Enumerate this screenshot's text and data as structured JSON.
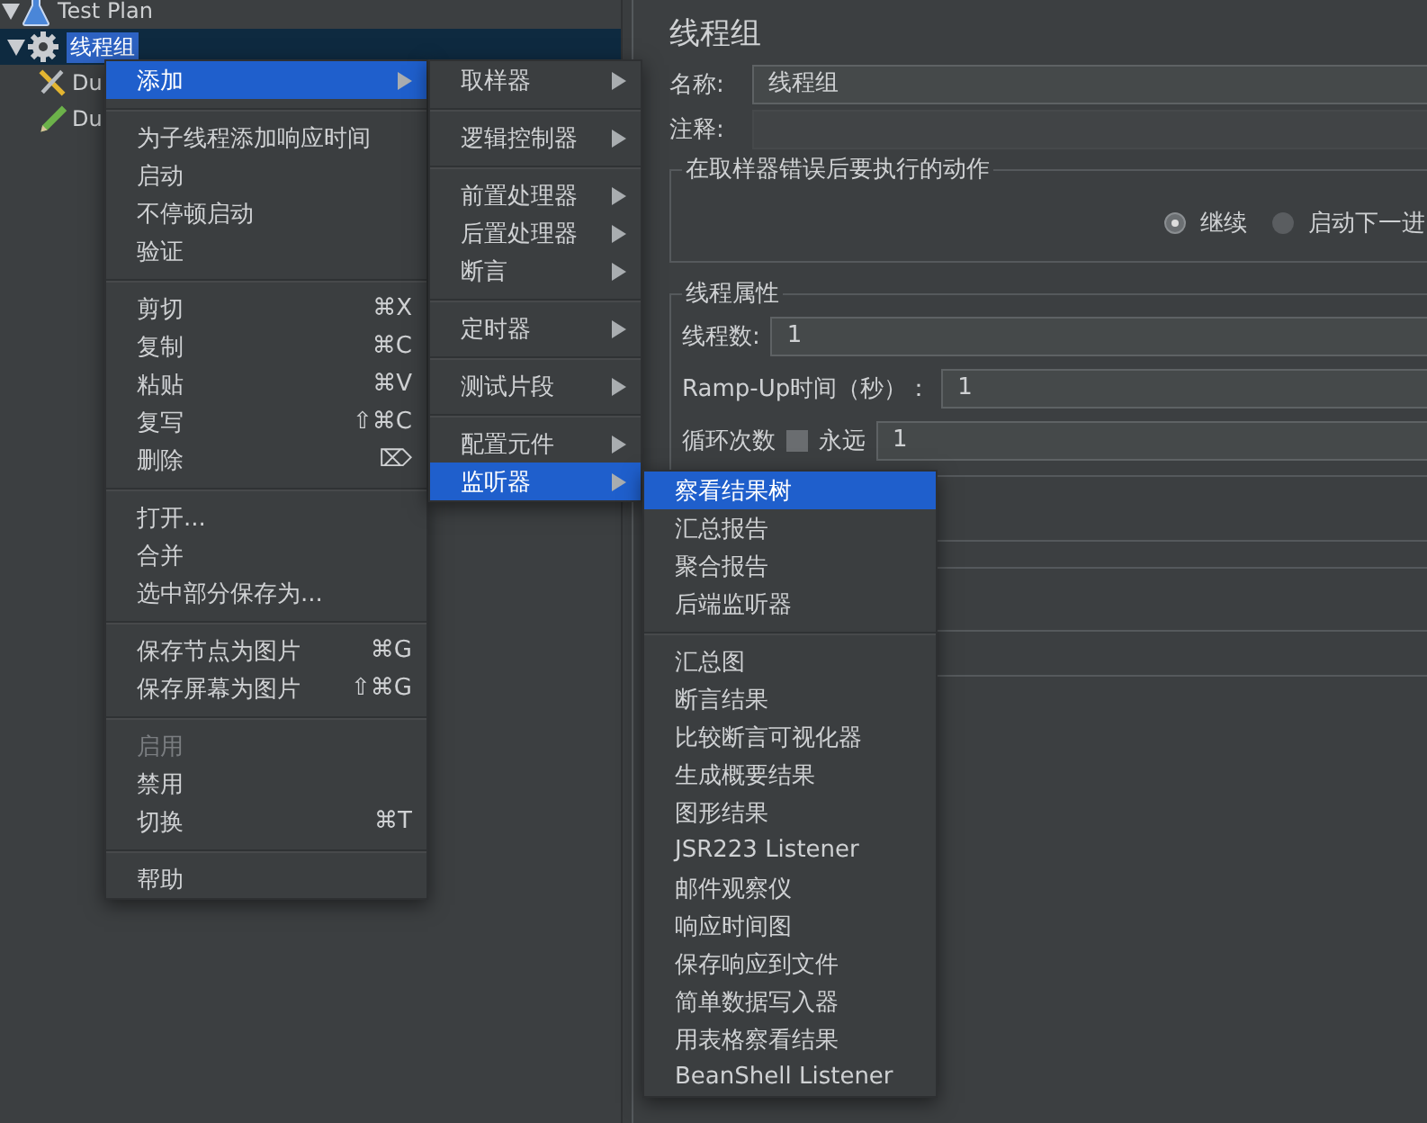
{
  "tree": [
    {
      "label": "Test Plan",
      "kind": "plan",
      "selected": false,
      "expanded": true,
      "children": [
        {
          "label": "线程组",
          "kind": "group",
          "selected": true,
          "expanded": true,
          "children": [
            {
              "label": "Du",
              "kind": "tool",
              "selected": false
            },
            {
              "label": "Du",
              "kind": "script",
              "selected": false
            }
          ]
        }
      ]
    }
  ],
  "panel": {
    "title": "线程组",
    "name_label": "名称:",
    "name_value": "线程组",
    "comment_label": "注释:",
    "error_action": {
      "legend": "在取样器错误后要执行的动作",
      "options": [
        {
          "label": "继续",
          "selected": true
        },
        {
          "label": "启动下一进",
          "selected": false
        }
      ]
    },
    "thread_props": {
      "legend": "线程属性",
      "threads_label": "线程数:",
      "threads_value": "1",
      "rampup_label": "Ramp-Up时间（秒）：",
      "rampup_value": "1",
      "loop_label": "循环次数",
      "forever": {
        "label": "永远",
        "checked": false
      },
      "loop_value": "1"
    }
  },
  "context_menu": {
    "groups": [
      {
        "items": [
          {
            "label": "添加",
            "submenu": true,
            "selected": true,
            "disabled": false
          }
        ]
      },
      {
        "items": [
          {
            "label": "为子线程添加响应时间",
            "selected": false,
            "disabled": false
          },
          {
            "label": "启动",
            "selected": false,
            "disabled": false
          },
          {
            "label": "不停顿启动",
            "selected": false,
            "disabled": false
          },
          {
            "label": "验证",
            "selected": false,
            "disabled": false
          }
        ]
      },
      {
        "items": [
          {
            "label": "剪切",
            "shortcut": "⌘X",
            "selected": false,
            "disabled": false
          },
          {
            "label": "复制",
            "shortcut": "⌘C",
            "selected": false,
            "disabled": false
          },
          {
            "label": "粘贴",
            "shortcut": "⌘V",
            "selected": false,
            "disabled": false
          },
          {
            "label": "复写",
            "shortcut": "⇧⌘C",
            "selected": false,
            "disabled": false
          },
          {
            "label": "删除",
            "shortcut": "⌦",
            "selected": false,
            "disabled": false
          }
        ]
      },
      {
        "items": [
          {
            "label": "打开...",
            "selected": false,
            "disabled": false
          },
          {
            "label": "合并",
            "selected": false,
            "disabled": false
          },
          {
            "label": "选中部分保存为...",
            "selected": false,
            "disabled": false
          }
        ]
      },
      {
        "items": [
          {
            "label": "保存节点为图片",
            "shortcut": "⌘G",
            "selected": false,
            "disabled": false
          },
          {
            "label": "保存屏幕为图片",
            "shortcut": "⇧⌘G",
            "selected": false,
            "disabled": false
          }
        ]
      },
      {
        "items": [
          {
            "label": "启用",
            "selected": false,
            "disabled": true
          },
          {
            "label": "禁用",
            "selected": false,
            "disabled": false
          },
          {
            "label": "切换",
            "shortcut": "⌘T",
            "selected": false,
            "disabled": false
          }
        ]
      },
      {
        "items": [
          {
            "label": "帮助",
            "selected": false,
            "disabled": false
          }
        ]
      }
    ]
  },
  "add_submenu": {
    "groups": [
      {
        "items": [
          {
            "label": "取样器",
            "submenu": true,
            "selected": false
          }
        ]
      },
      {
        "items": [
          {
            "label": "逻辑控制器",
            "submenu": true,
            "selected": false
          }
        ]
      },
      {
        "items": [
          {
            "label": "前置处理器",
            "submenu": true,
            "selected": false
          },
          {
            "label": "后置处理器",
            "submenu": true,
            "selected": false
          },
          {
            "label": "断言",
            "submenu": true,
            "selected": false
          }
        ]
      },
      {
        "items": [
          {
            "label": "定时器",
            "submenu": true,
            "selected": false
          }
        ]
      },
      {
        "items": [
          {
            "label": "测试片段",
            "submenu": true,
            "selected": false
          }
        ]
      },
      {
        "items": [
          {
            "label": "配置元件",
            "submenu": true,
            "selected": false
          },
          {
            "label": "监听器",
            "submenu": true,
            "selected": true
          }
        ]
      }
    ]
  },
  "listener_submenu": {
    "groups": [
      {
        "items": [
          {
            "label": "察看结果树",
            "selected": true
          },
          {
            "label": "汇总报告",
            "selected": false
          },
          {
            "label": "聚合报告",
            "selected": false
          },
          {
            "label": "后端监听器",
            "selected": false
          }
        ]
      },
      {
        "items": [
          {
            "label": "汇总图",
            "selected": false
          },
          {
            "label": "断言结果",
            "selected": false
          },
          {
            "label": "比较断言可视化器",
            "selected": false
          },
          {
            "label": "生成概要结果",
            "selected": false
          },
          {
            "label": "图形结果",
            "selected": false
          },
          {
            "label": "JSR223 Listener",
            "selected": false
          },
          {
            "label": "邮件观察仪",
            "selected": false
          },
          {
            "label": "响应时间图",
            "selected": false
          },
          {
            "label": "保存响应到文件",
            "selected": false
          },
          {
            "label": "简单数据写入器",
            "selected": false
          },
          {
            "label": "用表格察看结果",
            "selected": false
          },
          {
            "label": "BeanShell Listener",
            "selected": false
          }
        ]
      }
    ]
  }
}
